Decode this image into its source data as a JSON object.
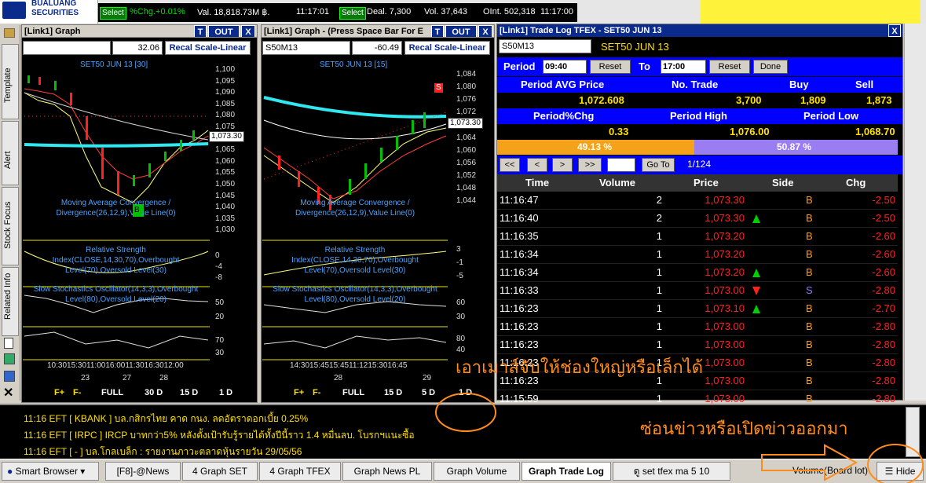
{
  "topbar": {
    "logo_line1": "BUALUANG",
    "logo_line2": "SECURITIES",
    "select1": "Select",
    "chg": "%Chg.+0.01%",
    "val": "Val. 18,818.73M ฿.",
    "time1": "11:17:01",
    "select2": "Select",
    "deal": "Deal. 7,300",
    "vol": "Vol. 37,643",
    "oint": "OInt. 502,318",
    "time2": "11:17:00"
  },
  "lefttabs": [
    "Template",
    "Alert",
    "Stock Focus",
    "Related Info"
  ],
  "graph1": {
    "title": "[Link1] Graph",
    "t": "T",
    "out": "OUT",
    "x": "X",
    "value": "32.06",
    "recal": "Recal Scale-Linear",
    "symbol": "SET50 JUN 13   [30]",
    "price_box": "1,073.30",
    "b_marker": "B",
    "yticks": [
      "1,100",
      "1,095",
      "1,090",
      "1,085",
      "1,080",
      "1,075",
      "1,070",
      "1,065",
      "1,060",
      "1,055",
      "1,050",
      "1,045",
      "1,040",
      "1,035",
      "1,030"
    ],
    "macd": "Moving Average Convergence / Divergence(26,12,9),Value Line(0)",
    "macd_ticks": [
      "0",
      "-4",
      "-8"
    ],
    "rsi": "Relative Strength Index(CLOSE,14,30,70),Overbought Level(70),Oversold Level(30)",
    "rsi_ticks": [
      "50",
      "20"
    ],
    "stoch": "Slow Stochastics Oscillator(14,3,3),Overbought Level(80),Oversold Level(20)",
    "stoch_ticks": [
      "70",
      "30"
    ],
    "times": "10:3015:3011:0016:0011:3016:3012:00",
    "dates": [
      "23",
      "27",
      "28"
    ],
    "nav": [
      "F+",
      "F-",
      "FULL",
      "30 D",
      "15 D",
      "1 D"
    ]
  },
  "graph2": {
    "title": "[Link1] Graph - (Press Space Bar For E",
    "t": "T",
    "out": "OUT",
    "x": "X",
    "combo": "S50M13",
    "value": "-60.49",
    "recal": "Recal Scale-Linear",
    "symbol": "SET50 JUN 13   [15]",
    "price_box": "1,073.30",
    "s_marker": "S",
    "yticks": [
      "1,084",
      "1,080",
      "1,076",
      "1,072",
      "1,068",
      "1,064",
      "1,060",
      "1,056",
      "1,052",
      "1,048",
      "1,044"
    ],
    "macd": "Moving Average Convergence / Divergence(26,12,9),Value Line(0)",
    "macd_ticks": [
      "3",
      "-1",
      "-5"
    ],
    "rsi": "Relative Strength Index(CLOSE,14,30,70),Overbought Level(70),Oversold Level(30)",
    "rsi_ticks": [
      "60",
      "30"
    ],
    "stoch": "Slow Stochastics Oscillator(14,3,3),Overbought Level(80),Oversold Level(20)",
    "stoch_ticks": [
      "80",
      "40"
    ],
    "times": "14:3015:4515:4511:1215:3016:45",
    "dates": [
      "28",
      "29"
    ],
    "nav": [
      "F+",
      "F-",
      "FULL",
      "15 D",
      "5 D",
      "1 D"
    ]
  },
  "tradelog": {
    "title": "[Link1] Trade Log TFEX - SET50 JUN 13",
    "x": "X",
    "combo": "S50M13",
    "symbol": "SET50 JUN 13",
    "period_label": "Period",
    "period_from": "09:40",
    "reset1": "Reset",
    "to_label": "To",
    "period_to": "17:00",
    "reset2": "Reset",
    "done": "Done",
    "h_avg": "Period AVG Price",
    "h_trade": "No. Trade",
    "h_buy": "Buy",
    "h_sell": "Sell",
    "avg": "1,072.608",
    "trades": "3,700",
    "buy": "1,809",
    "sell": "1,873",
    "h_pchg": "Period%Chg",
    "h_high": "Period High",
    "h_low": "Period Low",
    "pchg": "0.33",
    "high": "1,076.00",
    "low": "1,068.70",
    "buy_pct": "49.13 %",
    "sell_pct": "50.87 %",
    "buy_fraction": 0.4913,
    "nav": [
      "<<",
      "<",
      ">",
      ">>"
    ],
    "goto": "Go To",
    "page": "1/124",
    "cols": [
      "Time",
      "Volume",
      "Price",
      "Side",
      "Chg"
    ],
    "rows": [
      {
        "time": "11:16:47",
        "vol": "2",
        "price": "1,073.30",
        "arrow": "",
        "side": "B",
        "chg": "-2.50"
      },
      {
        "time": "11:16:40",
        "vol": "2",
        "price": "1,073.30",
        "arrow": "up",
        "side": "B",
        "chg": "-2.50"
      },
      {
        "time": "11:16:35",
        "vol": "1",
        "price": "1,073.20",
        "arrow": "",
        "side": "B",
        "chg": "-2.60"
      },
      {
        "time": "11:16:34",
        "vol": "1",
        "price": "1,073.20",
        "arrow": "",
        "side": "B",
        "chg": "-2.60"
      },
      {
        "time": "11:16:34",
        "vol": "1",
        "price": "1,073.20",
        "arrow": "up",
        "side": "B",
        "chg": "-2.60"
      },
      {
        "time": "11:16:33",
        "vol": "1",
        "price": "1,073.00",
        "arrow": "down",
        "side": "S",
        "chg": "-2.80"
      },
      {
        "time": "11:16:23",
        "vol": "1",
        "price": "1,073.10",
        "arrow": "up",
        "side": "B",
        "chg": "-2.70"
      },
      {
        "time": "11:16:23",
        "vol": "1",
        "price": "1,073.00",
        "arrow": "",
        "side": "B",
        "chg": "-2.80"
      },
      {
        "time": "11:16:23",
        "vol": "1",
        "price": "1,073.00",
        "arrow": "",
        "side": "B",
        "chg": "-2.80"
      },
      {
        "time": "11:16:23",
        "vol": "1",
        "price": "1,073.00",
        "arrow": "",
        "side": "B",
        "chg": "-2.80"
      },
      {
        "time": "11:16:23",
        "vol": "1",
        "price": "1,073.00",
        "arrow": "",
        "side": "B",
        "chg": "-2.80"
      },
      {
        "time": "11:15:59",
        "vol": "1",
        "price": "1,073.00",
        "arrow": "",
        "side": "B",
        "chg": "-2.80"
      }
    ]
  },
  "news": [
    "11:16  EFT  [ KBANK ]  บล.กสิกรไทย คาด กนง. ลดอัตราดอกเบี้ย 0.25%",
    "11:16  EFT  [ IRPC ]  IRCP บาทกว่า5% หลังตั้งเป้ารับรู้รายได้ทั้งปีนี้ราว 1.4 หมื่นลบ. โบรกฯแนะซื้อ",
    "11:16  EFT  [ - ]  บล.โกลเบล็ก : รายงานภาวะตลาดหุ้นรายวัน 29/05/56"
  ],
  "annotations": {
    "resize": "เอาเมาส์จับให้ช่องใหญ่หรือเล็กได้",
    "hide_news": "ซ่อนข่าวหรือเปิดข่าวออกมา"
  },
  "taskbar": {
    "smart": "Smart Browser",
    "tabs": [
      "[F8]-@News",
      "4 Graph SET",
      "4 Graph TFEX",
      "Graph News PL",
      "Graph Volume",
      "Graph Trade Log",
      "ดู set tfex ma 5 10"
    ],
    "volume": "Volume(Board lot)",
    "hide": "Hide"
  }
}
